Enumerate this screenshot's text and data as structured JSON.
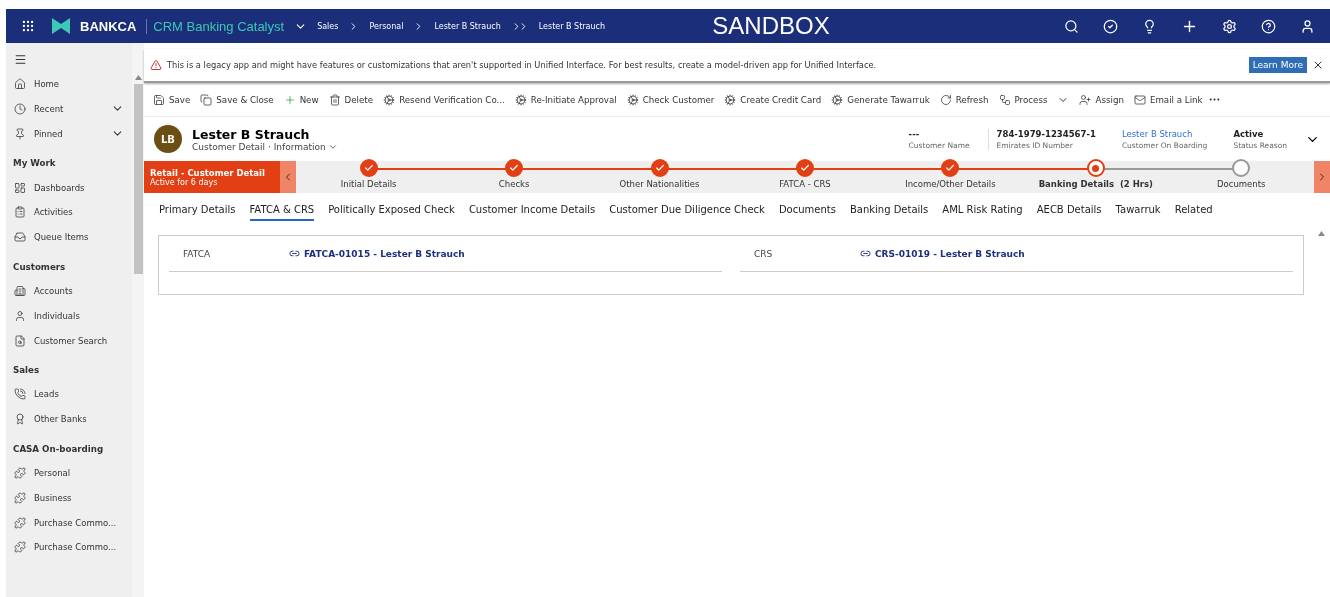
{
  "topbar": {
    "brand": "BANKCA",
    "app": "CRM Banking Catalyst",
    "breadcrumbs": [
      "Sales",
      "Personal",
      "Lester B Strauch"
    ],
    "breadcrumb_last": "Lester B Strauch",
    "environment": "SANDBOX"
  },
  "sidebar": {
    "top": [
      {
        "label": "Home",
        "expandable": false
      },
      {
        "label": "Recent",
        "expandable": true
      },
      {
        "label": "Pinned",
        "expandable": true
      }
    ],
    "groups": [
      {
        "title": "My Work",
        "items": [
          {
            "label": "Dashboards"
          },
          {
            "label": "Activities"
          },
          {
            "label": "Queue Items"
          }
        ]
      },
      {
        "title": "Customers",
        "items": [
          {
            "label": "Accounts"
          },
          {
            "label": "Individuals"
          },
          {
            "label": "Customer Search"
          }
        ]
      },
      {
        "title": "Sales",
        "items": [
          {
            "label": "Leads"
          },
          {
            "label": "Other Banks"
          }
        ]
      },
      {
        "title": "CASA On-boarding",
        "items": [
          {
            "label": "Personal"
          },
          {
            "label": "Business"
          },
          {
            "label": "Purchase Commo..."
          },
          {
            "label": "Purchase Commo..."
          }
        ]
      }
    ]
  },
  "notice": {
    "text": "This is a legacy app and might have features or customizations that aren't supported in Unified Interface. For best results, create a model-driven app for Unified Interface.",
    "button": "Learn More"
  },
  "commands": [
    {
      "label": "Save",
      "dropdown": false
    },
    {
      "label": "Save & Close",
      "dropdown": false
    },
    {
      "label": "New",
      "dropdown": false
    },
    {
      "label": "Delete",
      "dropdown": false
    },
    {
      "label": "Resend Verification Co...",
      "dropdown": false
    },
    {
      "label": "Re-Initiate Approval",
      "dropdown": false
    },
    {
      "label": "Check Customer",
      "dropdown": false
    },
    {
      "label": "Create Credit Card",
      "dropdown": false
    },
    {
      "label": "Generate Tawarruk",
      "dropdown": false
    },
    {
      "label": "Refresh",
      "dropdown": false
    },
    {
      "label": "Process",
      "dropdown": true
    },
    {
      "label": "Assign",
      "dropdown": false
    },
    {
      "label": "Email a Link",
      "dropdown": false
    }
  ],
  "record": {
    "initials": "LB",
    "name": "Lester B Strauch",
    "subtitle": "Customer Detail · Information",
    "fields": [
      {
        "value": "---",
        "label": "Customer Name",
        "link": false
      },
      {
        "value": "784-1979-1234567-1",
        "label": "Emirates ID Number",
        "link": false
      },
      {
        "value": "Lester B Strauch",
        "label": "Customer On Boarding",
        "link": true
      },
      {
        "value": "Active",
        "label": "Status Reason",
        "link": false
      }
    ]
  },
  "process": {
    "name": "Retail - Customer Detail",
    "duration": "Active for 6 days",
    "stages": [
      {
        "label": "Initial Details",
        "done": true,
        "active": false
      },
      {
        "label": "Checks",
        "done": true,
        "active": false
      },
      {
        "label": "Other Nationalities",
        "done": true,
        "active": false
      },
      {
        "label": "FATCA - CRS",
        "done": true,
        "active": false
      },
      {
        "label": "Income/Other Details",
        "done": true,
        "active": false
      },
      {
        "label": "Banking Details  (2 Hrs)",
        "done": false,
        "active": true
      },
      {
        "label": "Documents",
        "done": false,
        "active": false
      }
    ]
  },
  "tabs": [
    {
      "label": "Primary Details",
      "selected": false
    },
    {
      "label": "FATCA & CRS",
      "selected": true
    },
    {
      "label": "Politically Exposed Check",
      "selected": false
    },
    {
      "label": "Customer Income Details",
      "selected": false
    },
    {
      "label": "Customer Due Diligence Check",
      "selected": false
    },
    {
      "label": "Documents",
      "selected": false
    },
    {
      "label": "Banking Details",
      "selected": false
    },
    {
      "label": "AML Risk Rating",
      "selected": false
    },
    {
      "label": "AECB Details",
      "selected": false
    },
    {
      "label": "Tawarruk",
      "selected": false
    },
    {
      "label": "Related",
      "selected": false
    }
  ],
  "lookups": [
    {
      "label": "FATCA",
      "value": "FATCA-01015 - Lester B Strauch"
    },
    {
      "label": "CRS",
      "value": "CRS-01019 - Lester B Strauch"
    }
  ]
}
